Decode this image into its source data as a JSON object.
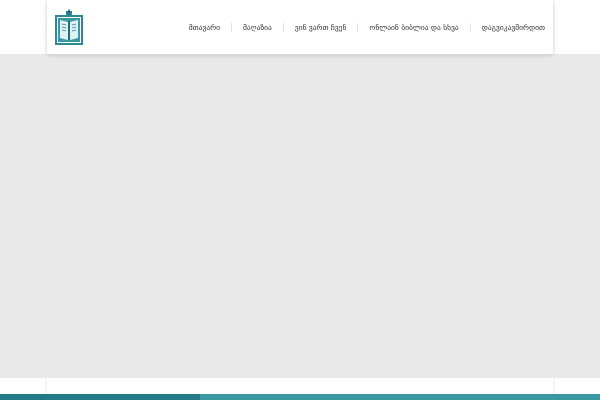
{
  "header": {
    "nav": [
      {
        "label": "მთავარი"
      },
      {
        "label": "მაღაზია"
      },
      {
        "label": "ვინ ვართ ჩვენ"
      },
      {
        "label": "ონლაინ ბიბლია და სხვა"
      },
      {
        "label": "დაგვიკავშირდით"
      }
    ]
  },
  "colors": {
    "hero_background": "#e9e9e9",
    "accent_dark": "#237a84",
    "accent_light": "#3a98a3",
    "logo_teal": "#2d8a96"
  },
  "icons": {
    "logo": "book-logo-icon"
  }
}
